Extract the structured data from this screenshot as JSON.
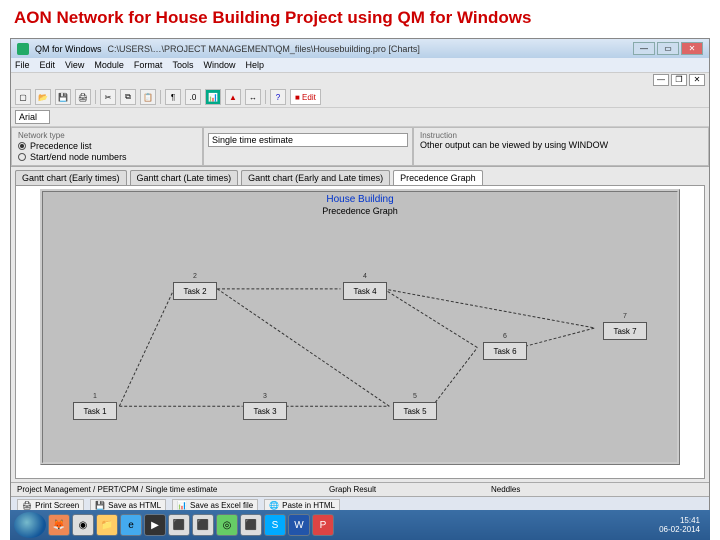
{
  "slide_title": "AON Network for House Building Project using QM for Windows",
  "titlebar": {
    "app": "QM for Windows",
    "path": "C:\\USERS\\…\\PROJECT MANAGEMENT\\QM_files\\Housebuilding.pro  [Charts]"
  },
  "menu": [
    "File",
    "Edit",
    "View",
    "Module",
    "Format",
    "Tools",
    "Window",
    "Help"
  ],
  "font": {
    "family": "Arial"
  },
  "options": {
    "left_title": "Network type",
    "r1": "Precedence list",
    "r2": "Start/end node numbers",
    "mid_label": "Single time estimate",
    "right_title": "Instruction",
    "right_text": "Other output can be viewed by using WINDOW"
  },
  "tabs": [
    "Gantt chart (Early times)",
    "Gantt chart (Late times)",
    "Gantt chart (Early and Late times)",
    "Precedence Graph"
  ],
  "graph": {
    "title": "House Building",
    "subtitle": "Precedence Graph"
  },
  "nodes": {
    "n1": {
      "num": "1",
      "label": "Task 1"
    },
    "n2": {
      "num": "2",
      "label": "Task 2"
    },
    "n3": {
      "num": "3",
      "label": "Task 3"
    },
    "n4": {
      "num": "4",
      "label": "Task 4"
    },
    "n5": {
      "num": "5",
      "label": "Task 5"
    },
    "n6": {
      "num": "6",
      "label": "Task 6"
    },
    "n7": {
      "num": "7",
      "label": "Task 7"
    }
  },
  "status": {
    "left": "Project Management / PERT/CPM / Single time estimate",
    "mid": "Graph Result",
    "right": "Neddles"
  },
  "actions": [
    "Print Screen",
    "Save as HTML",
    "Save as Excel file",
    "Paste in HTML"
  ],
  "clock": {
    "time": "15:41",
    "date": "06-02-2014"
  }
}
